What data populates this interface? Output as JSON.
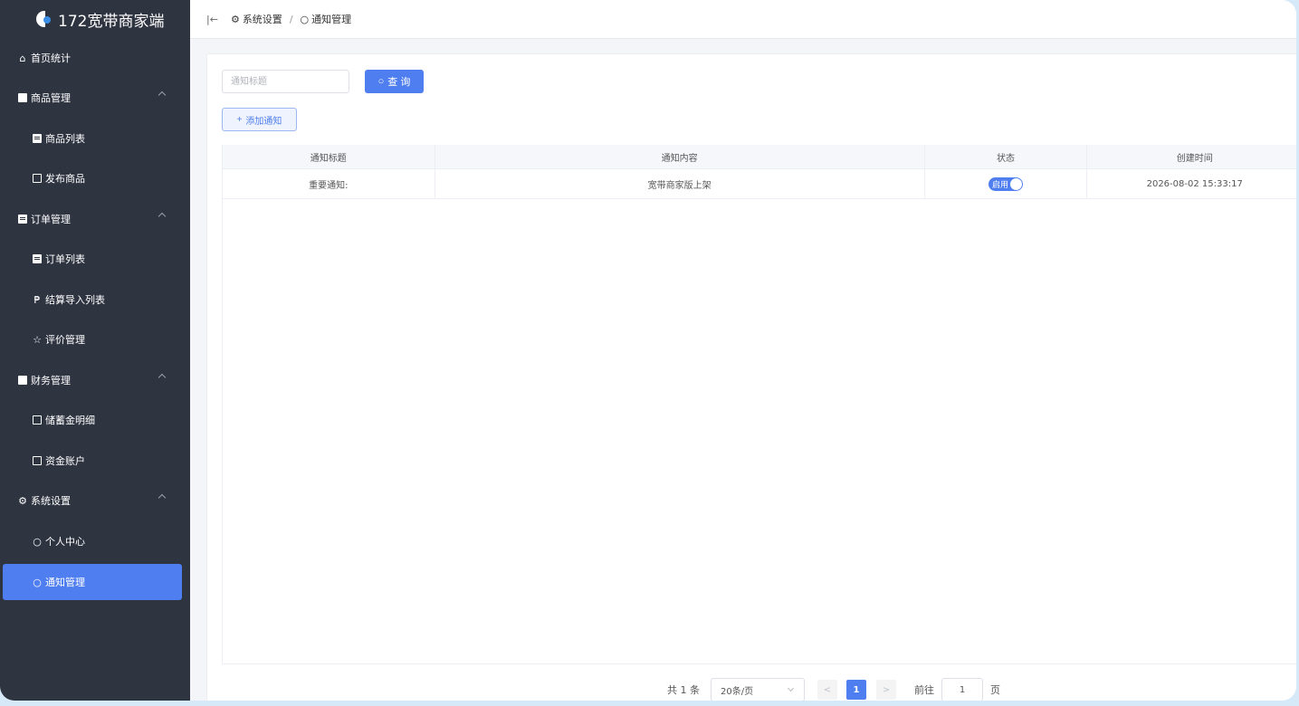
{
  "app": {
    "title": "172宽带商家端"
  },
  "sidebar": {
    "items": [
      {
        "label": "首页统计",
        "icon": "home-icon"
      },
      {
        "label": "商品管理",
        "icon": "goods-icon"
      },
      {
        "label": "商品列表",
        "icon": "list-icon"
      },
      {
        "label": "发布商品",
        "icon": "edit-icon"
      },
      {
        "label": "订单管理",
        "icon": "order-icon"
      },
      {
        "label": "订单列表",
        "icon": "list-icon"
      },
      {
        "label": "结算导入列表",
        "icon": "import-icon"
      },
      {
        "label": "评价管理",
        "icon": "star-icon"
      },
      {
        "label": "财务管理",
        "icon": "finance-icon"
      },
      {
        "label": "储蓄金明细",
        "icon": "savings-icon"
      },
      {
        "label": "资金账户",
        "icon": "account-icon"
      },
      {
        "label": "系统设置",
        "icon": "gear-icon"
      },
      {
        "label": "个人中心",
        "icon": "user-icon"
      },
      {
        "label": "通知管理",
        "icon": "bell-icon"
      }
    ]
  },
  "header": {
    "breadcrumb_parent": "系统设置",
    "breadcrumb_sep": "/",
    "breadcrumb_current": "通知管理"
  },
  "toolbar": {
    "search_placeholder": "通知标题",
    "query_label": "查 询",
    "add_label": "添加通知"
  },
  "table": {
    "columns": [
      "通知标题",
      "通知内容",
      "状态",
      "创建时间"
    ],
    "rows": [
      {
        "title": "重要通知:",
        "content": "宽带商家版上架",
        "status": "启用",
        "created": "2026-08-02 15:33:17"
      }
    ]
  },
  "pagination": {
    "total": "共 1 条",
    "page_size": "20条/页",
    "current_page": "1",
    "goto_label": "前往",
    "goto_value": "1",
    "goto_suffix": "页"
  },
  "colors": {
    "sidebar_bg": "#2f3441",
    "accent": "#4f7ef0"
  }
}
